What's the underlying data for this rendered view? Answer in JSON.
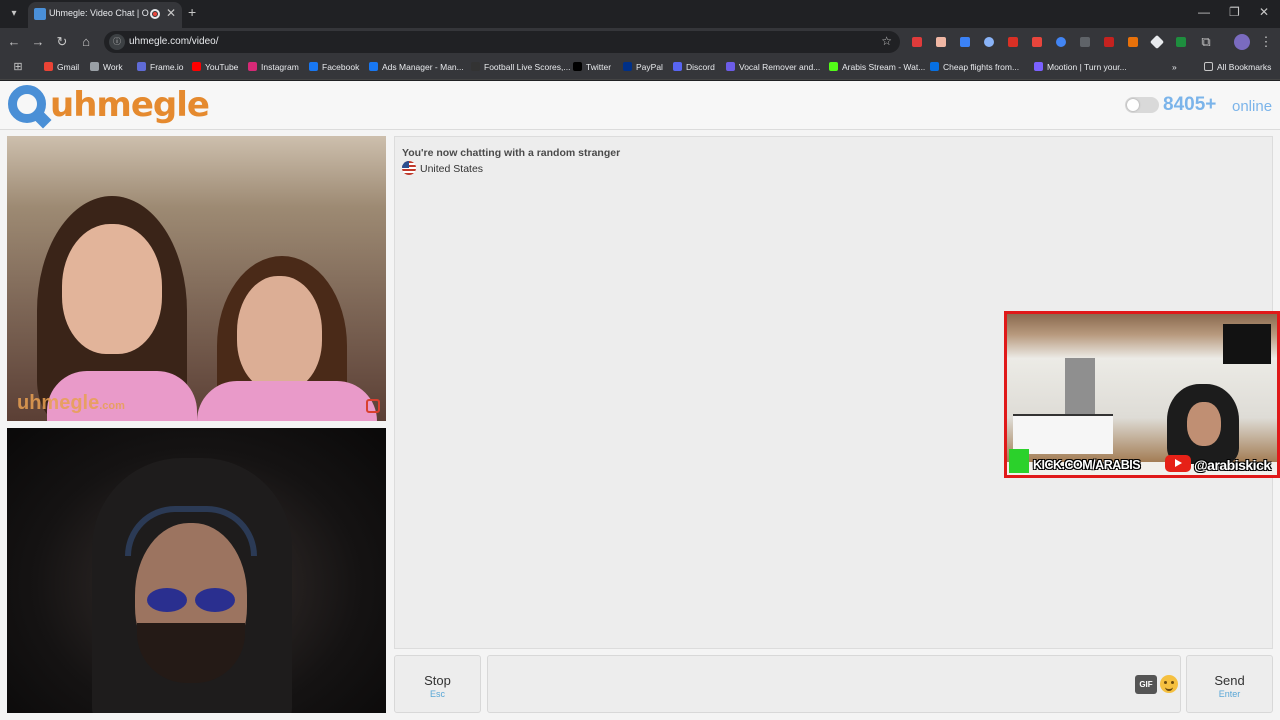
{
  "browser": {
    "tab_title": "Uhmegle: Video Chat | Omegle",
    "url": "uhmegle.com/video/",
    "icons": [
      "tab-search-icon",
      "back-icon",
      "forward-icon",
      "reload-icon",
      "home-icon",
      "star-icon",
      "extensions-icon",
      "menu-icon"
    ]
  },
  "bookmarks": [
    {
      "label": "Gmail",
      "color": "#ea4335"
    },
    {
      "label": "Work",
      "color": "#9aa0a6"
    },
    {
      "label": "Frame.io",
      "color": "#5f6bd6"
    },
    {
      "label": "YouTube",
      "color": "#ff0000"
    },
    {
      "label": "Instagram",
      "color": "#d62976"
    },
    {
      "label": "Facebook",
      "color": "#1877f2"
    },
    {
      "label": "Ads Manager - Man...",
      "color": "#1877f2"
    },
    {
      "label": "Football Live Scores,...",
      "color": "#333333"
    },
    {
      "label": "Twitter",
      "color": "#000000"
    },
    {
      "label": "PayPal",
      "color": "#003087"
    },
    {
      "label": "Discord",
      "color": "#5865f2"
    },
    {
      "label": "Vocal Remover and...",
      "color": "#6c5ce7"
    },
    {
      "label": "Arabis Stream - Wat...",
      "color": "#53fc18"
    },
    {
      "label": "Cheap flights from...",
      "color": "#0770e3"
    },
    {
      "label": "Mootion | Turn your...",
      "color": "#7b61ff"
    }
  ],
  "all_bookmarks": "All Bookmarks",
  "site": {
    "logo_text": "uhmegle",
    "online_count": "8405+",
    "online_label": "online"
  },
  "video": {
    "watermark_main": "uhmegle",
    "watermark_tld": ".com"
  },
  "chat": {
    "status": "You're now chatting with a random stranger",
    "country": "United States"
  },
  "stream_overlay": {
    "kick_text": "KICK.COM/ARABIS",
    "yt_text": "@arabiskick"
  },
  "controls": {
    "stop_label": "Stop",
    "stop_key": "Esc",
    "gif_label": "GIF",
    "send_label": "Send",
    "send_key": "Enter"
  }
}
